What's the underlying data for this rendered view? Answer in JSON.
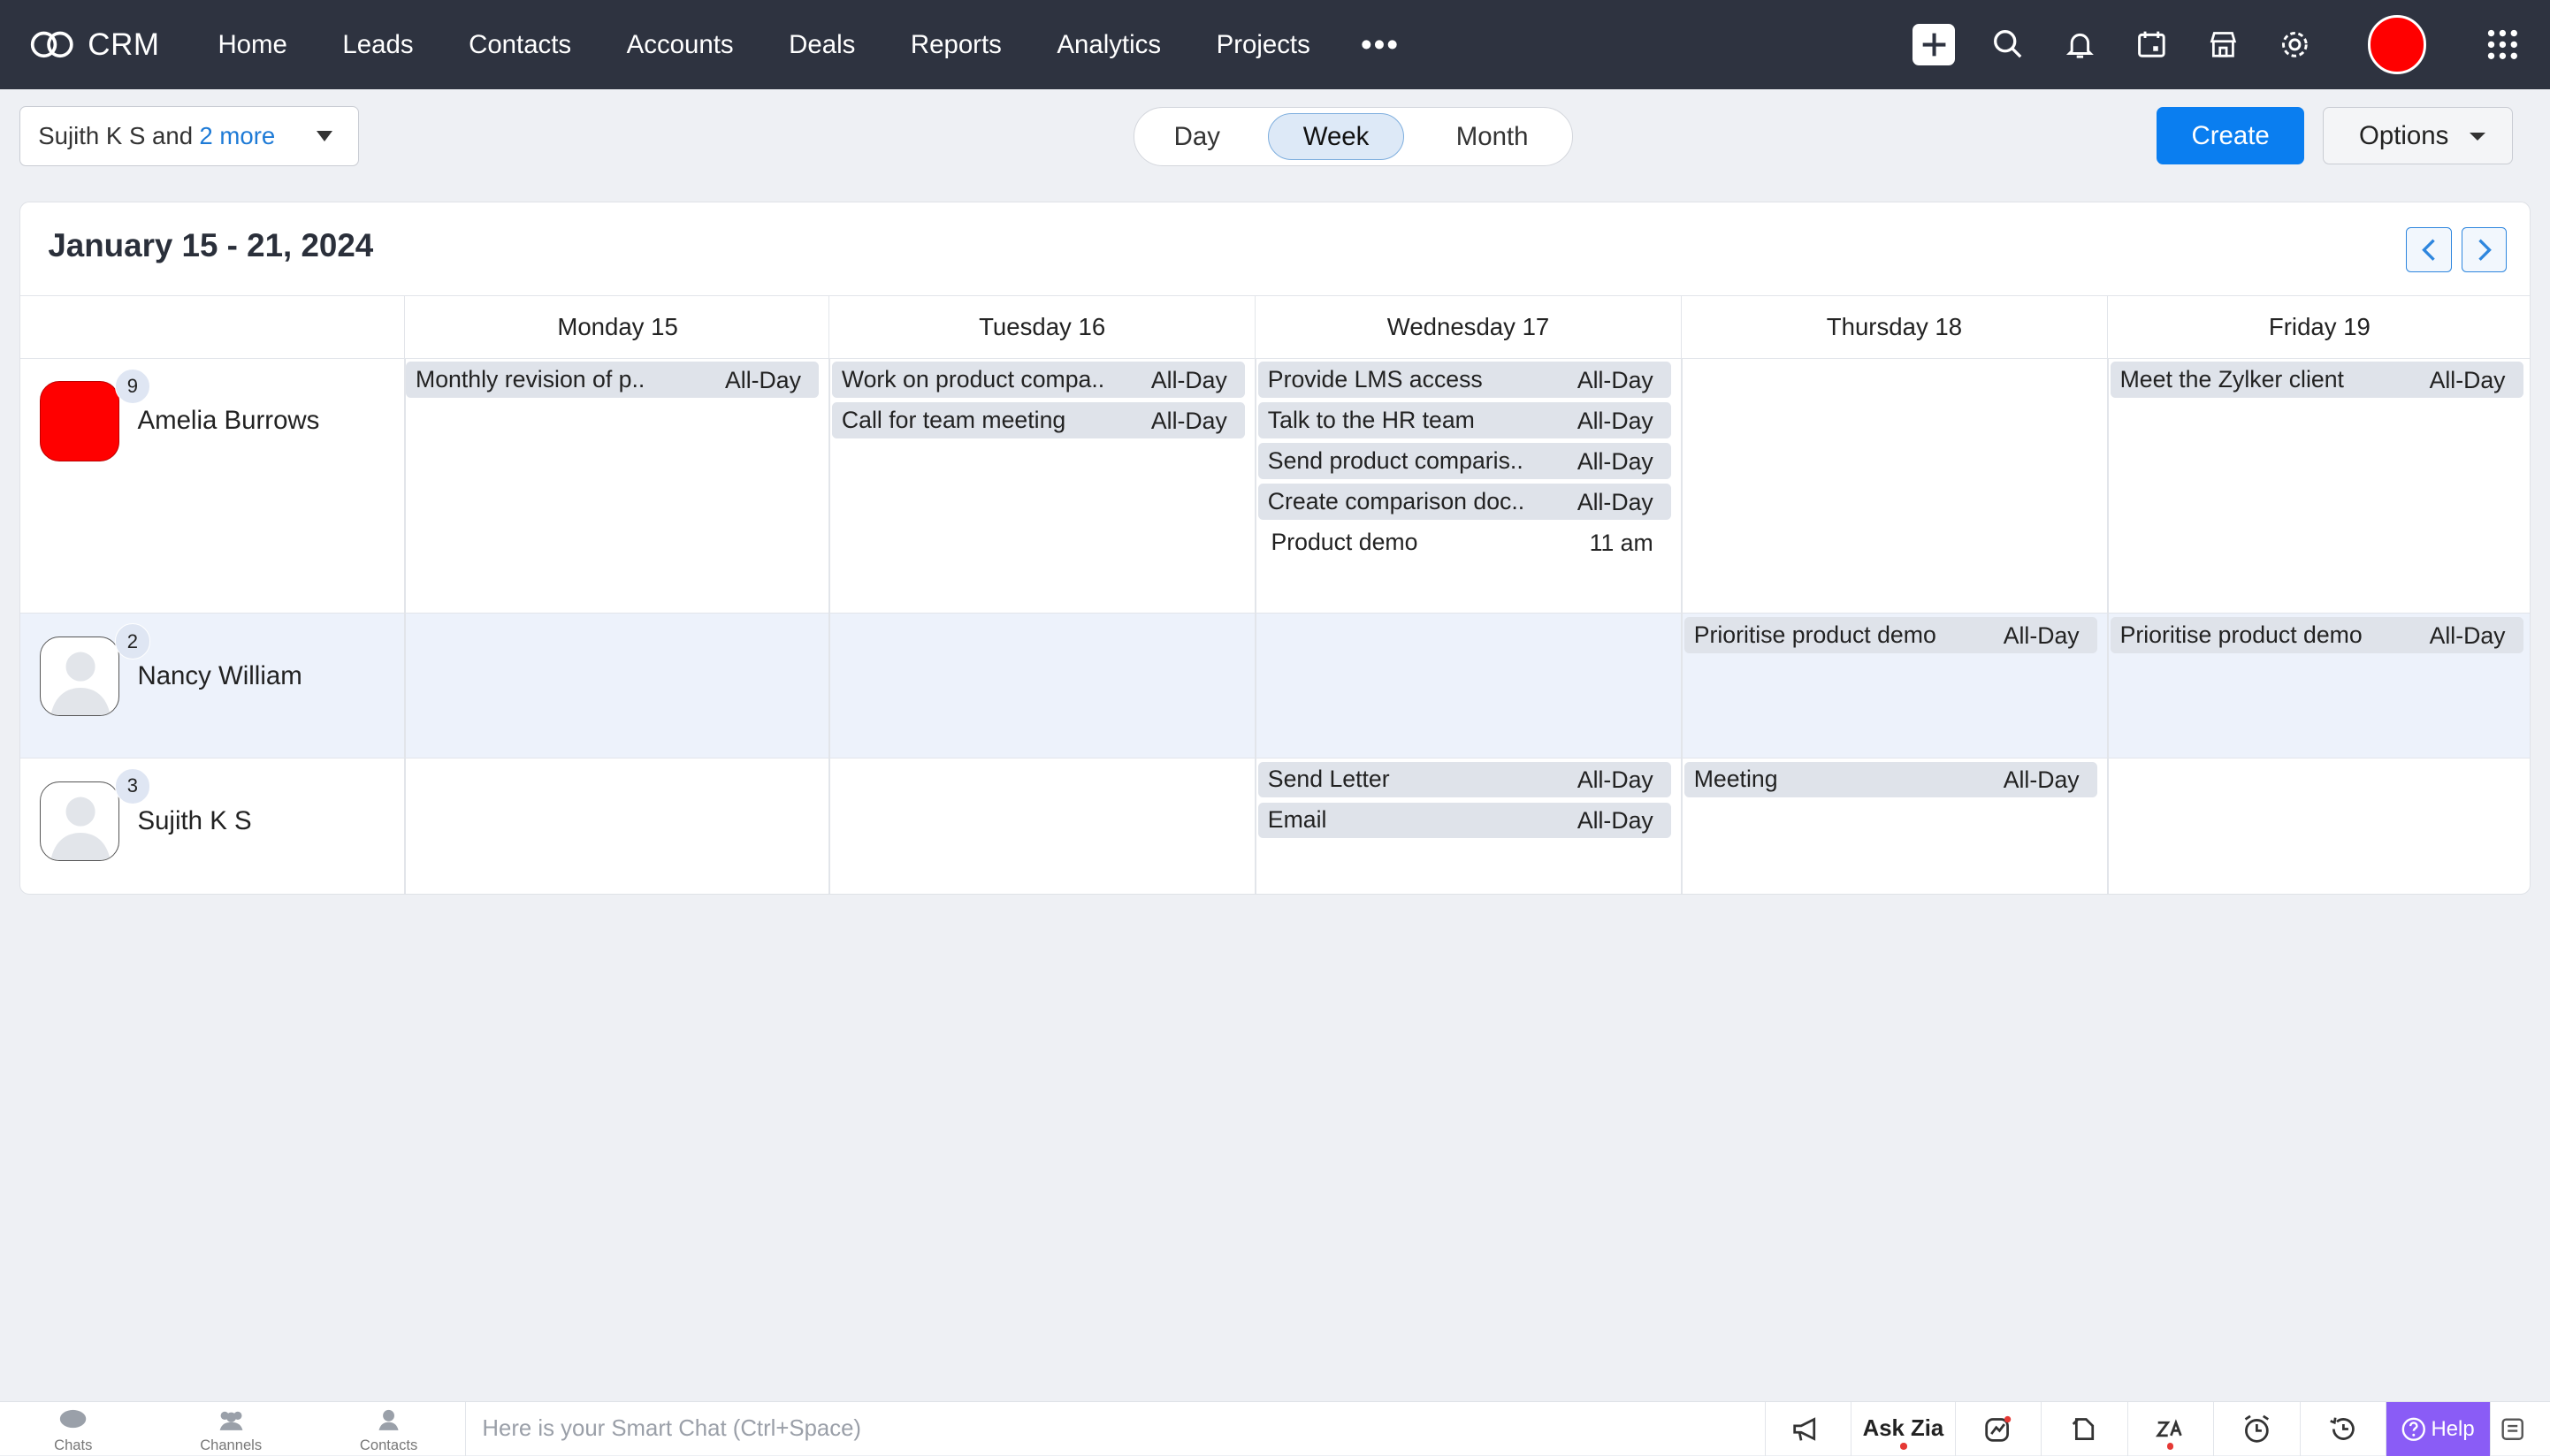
{
  "nav": {
    "brand": "CRM",
    "items": [
      "Home",
      "Leads",
      "Contacts",
      "Accounts",
      "Deals",
      "Reports",
      "Analytics",
      "Projects"
    ],
    "more": "•••"
  },
  "toolbar": {
    "user_filter_prefix": "Sujith K S and",
    "user_filter_more": "2 more",
    "views": {
      "day": "Day",
      "week": "Week",
      "month": "Month",
      "selected": "Week"
    },
    "create_label": "Create",
    "options_label": "Options"
  },
  "calendar": {
    "range_title": "January 15 - 21, 2024",
    "days": [
      "Monday 15",
      "Tuesday 16",
      "Wednesday 17",
      "Thursday 18",
      "Friday 19"
    ],
    "users": [
      {
        "name": "Amelia Burrows",
        "count": "9",
        "avatar": "red-square",
        "events": [
          {
            "day": 0,
            "title": "Monthly revision of p..",
            "time": "All-Day"
          },
          {
            "day": 1,
            "title": "Work on product compa..",
            "time": "All-Day"
          },
          {
            "day": 1,
            "title": "Call for team meeting",
            "time": "All-Day"
          },
          {
            "day": 2,
            "title": "Provide LMS access",
            "time": "All-Day"
          },
          {
            "day": 2,
            "title": "Talk to the HR team",
            "time": "All-Day"
          },
          {
            "day": 2,
            "title": "Send product comparis..",
            "time": "All-Day"
          },
          {
            "day": 2,
            "title": "Create comparison doc..",
            "time": "All-Day"
          },
          {
            "day": 2,
            "title": "Product demo",
            "time": "11 am"
          },
          {
            "day": 4,
            "title": "Meet the Zylker client",
            "time": "All-Day"
          }
        ]
      },
      {
        "name": "Nancy William",
        "count": "2",
        "avatar": "default-person",
        "events": [
          {
            "day": 3,
            "title": "Prioritise product demo",
            "time": "All-Day"
          },
          {
            "day": 4,
            "title": "Prioritise product demo",
            "time": "All-Day"
          }
        ]
      },
      {
        "name": "Sujith K S",
        "count": "3",
        "avatar": "default-person",
        "events": [
          {
            "day": 2,
            "title": "Send Letter",
            "time": "All-Day"
          },
          {
            "day": 2,
            "title": "Email",
            "time": "All-Day"
          },
          {
            "day": 3,
            "title": "Meeting",
            "time": "All-Day"
          }
        ]
      }
    ]
  },
  "bottom": {
    "tabs": [
      "Chats",
      "Channels",
      "Contacts"
    ],
    "smartchat_placeholder": "Here is your Smart Chat (Ctrl+Space)",
    "ask_zia": "Ask Zia",
    "help": "Help"
  },
  "colors": {
    "accent": "#0a7ef0",
    "nav_bg": "#2e3340",
    "help": "#8a5cf6",
    "profile": "#ff0000"
  }
}
